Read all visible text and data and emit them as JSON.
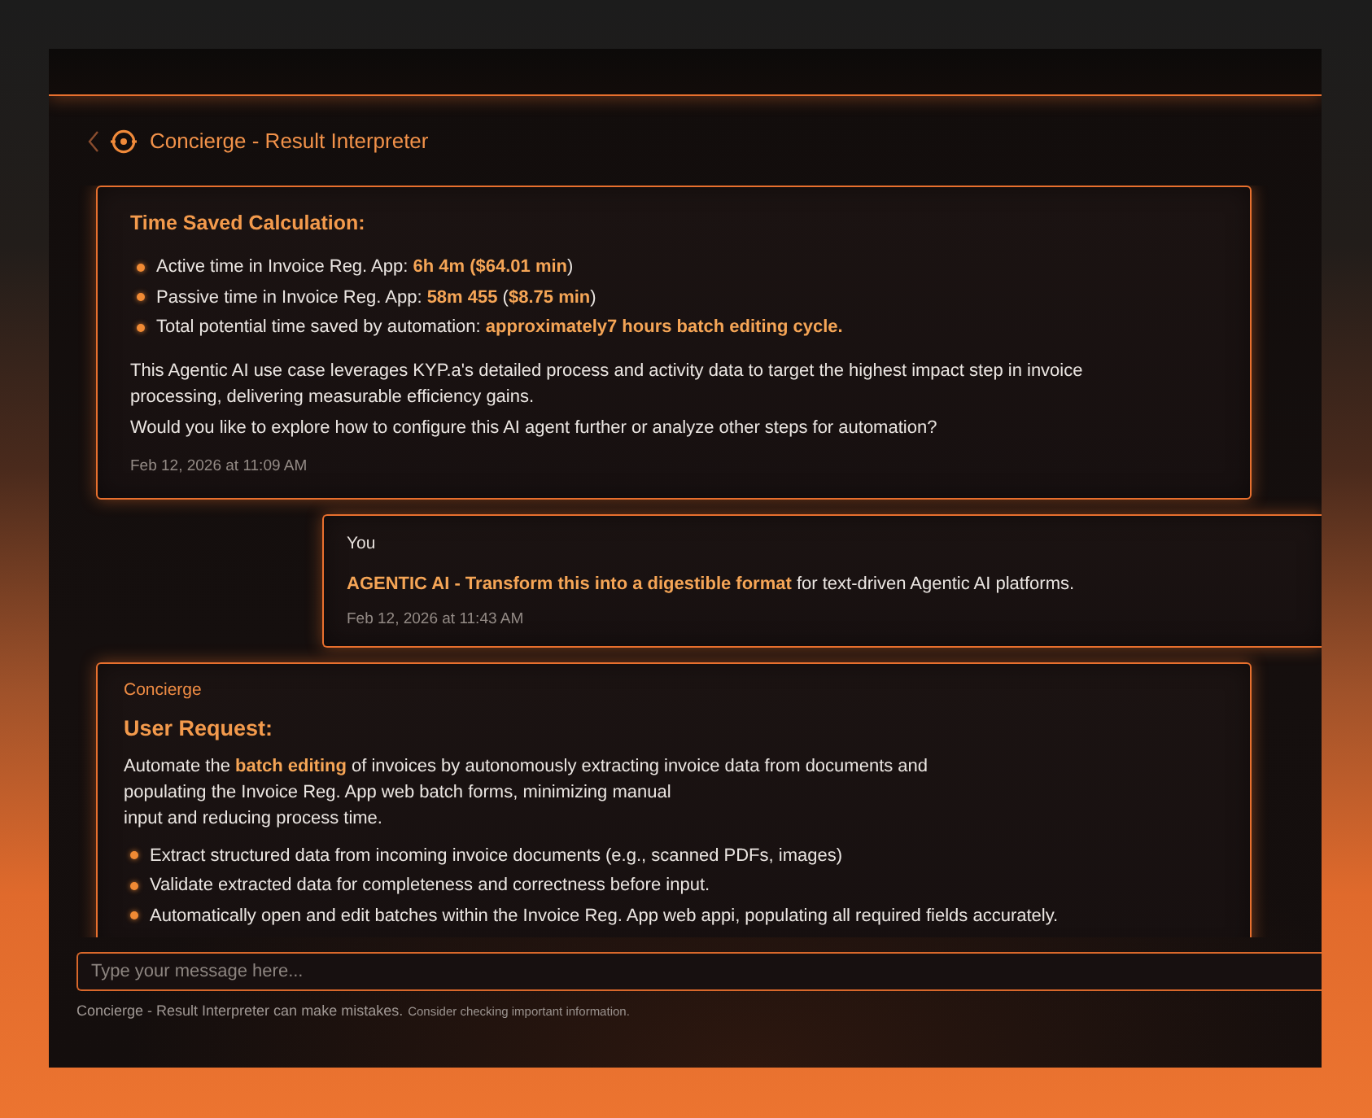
{
  "window": {
    "title": "Concierge - Result Interpreter"
  },
  "messages": [
    {
      "kind": "assistant",
      "blocks": [
        {
          "kind": "heading",
          "text": "Time Saved Calculation:"
        },
        {
          "kind": "bullets",
          "items": [
            "Active time in Invoice Reg. App: **6h 4m ($64.01 min**)",
            "Passive time in Invoice Reg. App: **58m 455** (**$8.75 min**)",
            "Total potential time saved by automation: **approximately7 hours batch editing cycle.**"
          ]
        },
        {
          "kind": "paragraph",
          "text": "This Agentic AI use case leverages KYP.a's detailed process and activity data to target the highest impact step in invoice\nprocessing, delivering measurable efficiency gains."
        },
        {
          "kind": "paragraph",
          "text": "Would you like to explore how to configure this AI agent further or analyze other steps for automation?"
        }
      ],
      "timestamp": "Feb 12, 2026 at 11:09 AM"
    },
    {
      "kind": "user",
      "sender": "You",
      "blocks": [
        {
          "kind": "paragraph",
          "text": "**AGENTIC AI - Transform this into a digestible format** for text-driven Agentic AI platforms."
        }
      ],
      "timestamp": "Feb 12, 2026 at 11:43 AM"
    },
    {
      "kind": "assistant",
      "sender": "Concierge",
      "blocks": [
        {
          "kind": "heading",
          "text": "User Request:"
        },
        {
          "kind": "paragraph",
          "text": "Automate the **batch editing** of invoices by autonomously extracting invoice data from documents and\npopulating the Invoice Reg. App web batch forms, minimizing manual\ninput and reducing process time."
        },
        {
          "kind": "bullets",
          "items": [
            "Extract structured data from incoming invoice documents (e.g., scanned PDFs, images)",
            "Validate extracted data for completeness and correctness before input.",
            "Automatically open and edit batches within the Invoice Reg. App web appi, populating all required fields accurately."
          ]
        }
      ]
    }
  ],
  "composer": {
    "placeholder": "Type your message here..."
  },
  "disclaimer": {
    "text": "Concierge - Result Interpreter can make mistakes.",
    "note": "Consider checking important information."
  }
}
